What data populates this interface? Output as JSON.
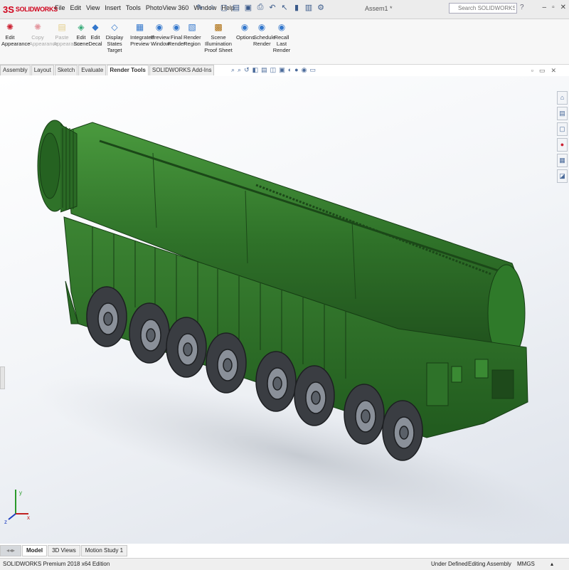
{
  "app": {
    "logo_mark": "3S",
    "logo_text": "SOLIDWORKS",
    "document_title": "Assem1 *",
    "search_placeholder": "Search SOLIDWORKS Help"
  },
  "menu": [
    "File",
    "Edit",
    "View",
    "Insert",
    "Tools",
    "PhotoView 360",
    "Window",
    "Help"
  ],
  "ribbon": {
    "commands": [
      {
        "label": "Edit Appearance",
        "icon": "appearance-icon",
        "enabled": true
      },
      {
        "label": "Copy Appearance",
        "icon": "copy-appearance-icon",
        "enabled": false
      },
      {
        "label": "Paste Appearance",
        "icon": "paste-appearance-icon",
        "enabled": false
      },
      {
        "label": "Edit Scene",
        "icon": "scene-icon",
        "enabled": true
      },
      {
        "label": "Edit Decal",
        "icon": "decal-icon",
        "enabled": true
      },
      {
        "label": "Display States Target",
        "icon": "display-states-icon",
        "enabled": true
      },
      {
        "label": "Integrated Preview",
        "icon": "integrated-preview-icon",
        "enabled": true
      },
      {
        "label": "Preview Window",
        "icon": "preview-window-icon",
        "enabled": true
      },
      {
        "label": "Final Render",
        "icon": "final-render-icon",
        "enabled": true
      },
      {
        "label": "Render Region",
        "icon": "render-region-icon",
        "enabled": true
      },
      {
        "label": "Scene Illumination Proof Sheet",
        "icon": "illumination-icon",
        "enabled": true
      },
      {
        "label": "Options",
        "icon": "options-icon",
        "enabled": true
      },
      {
        "label": "Schedule Render",
        "icon": "schedule-render-icon",
        "enabled": true
      },
      {
        "label": "Recall Last Render",
        "icon": "recall-render-icon",
        "enabled": true
      }
    ]
  },
  "tabs": [
    {
      "label": "Assembly",
      "active": false
    },
    {
      "label": "Layout",
      "active": false
    },
    {
      "label": "Sketch",
      "active": false
    },
    {
      "label": "Evaluate",
      "active": false
    },
    {
      "label": "Render Tools",
      "active": true
    },
    {
      "label": "SOLIDWORKS Add-Ins",
      "active": false
    }
  ],
  "bottom_tabs": [
    {
      "label": "Model",
      "active": true
    },
    {
      "label": "3D Views",
      "active": false
    },
    {
      "label": "Motion Study 1",
      "active": false
    }
  ],
  "status": {
    "edition": "SOLIDWORKS Premium 2018 x64 Edition",
    "definition": "Under Defined",
    "mode": "Editing Assembly",
    "units": "MMGS"
  },
  "triad": {
    "x": "x",
    "y": "y",
    "z": "z"
  },
  "colors": {
    "model_green": "#2f6e2a",
    "model_dark": "#1f4f1c",
    "wheel": "#3a3d42",
    "brand_red": "#d0021b"
  }
}
